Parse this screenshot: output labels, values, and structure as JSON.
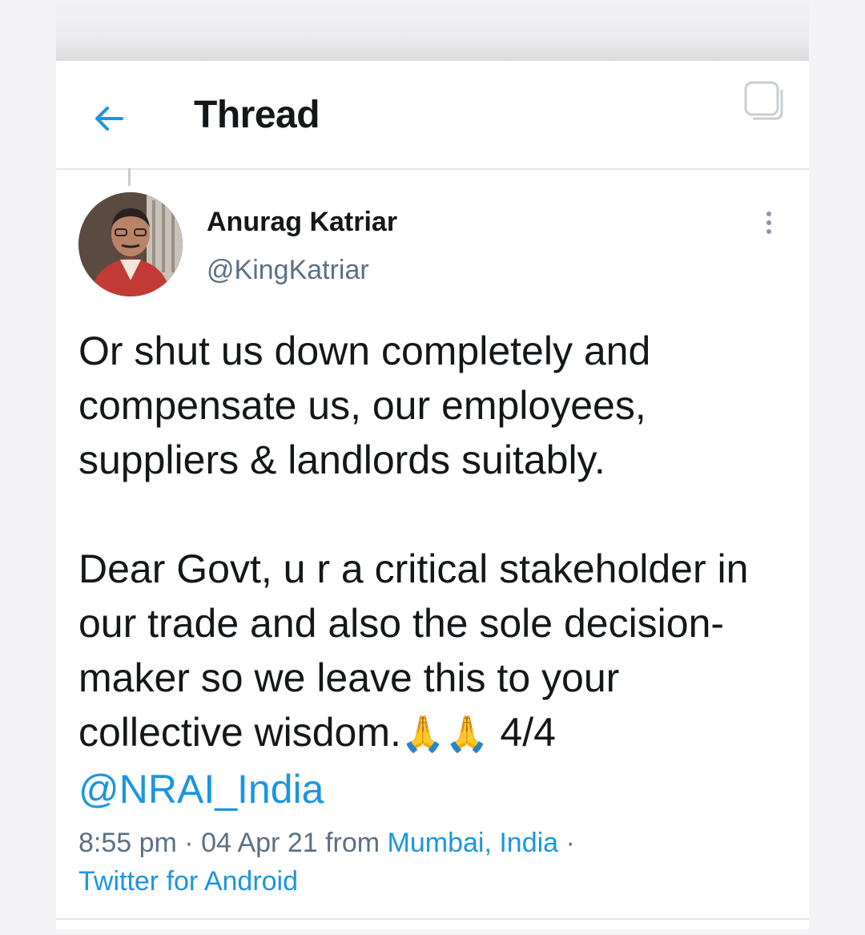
{
  "header": {
    "title": "Thread"
  },
  "tweet": {
    "author_name": "Anurag Katriar",
    "author_handle": "@KingKatriar",
    "paragraph1": "Or shut us down completely and compensate us, our employees, suppliers & landlords suitably.",
    "paragraph2_text": "Dear Govt, u r a critical stakeholder in our trade and also the sole decision-maker so we leave this to your collective wisdom.",
    "emoji": "🙏🙏",
    "thread_count": "4/4",
    "mention": "@NRAI_India",
    "time": "8:55 pm",
    "date": "04 Apr 21",
    "from_label": "from",
    "location": "Mumbai, India",
    "client": "Twitter for Android"
  },
  "icons": {
    "back": "arrow-left-icon",
    "corner": "square-icon",
    "more": "more-vertical-icon"
  },
  "colors": {
    "accent": "#1b95e0",
    "text": "#14171a",
    "secondary": "#5b7083"
  }
}
